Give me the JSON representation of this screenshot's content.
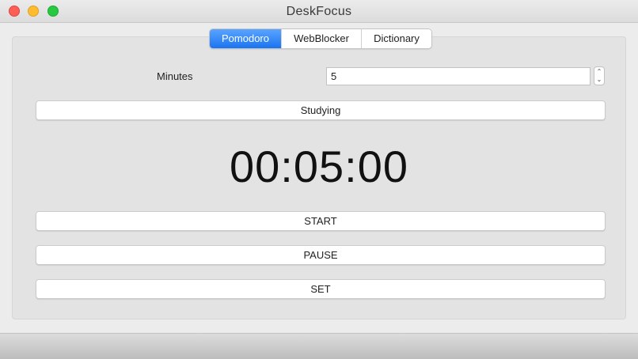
{
  "window": {
    "title": "DeskFocus",
    "accent_color": "#1a74f0",
    "traffic_colors": [
      "#fe5f57",
      "#febc2e",
      "#28c840"
    ]
  },
  "tabs": [
    {
      "label": "Pomodoro",
      "active": true
    },
    {
      "label": "WebBlocker",
      "active": false
    },
    {
      "label": "Dictionary",
      "active": false
    }
  ],
  "pomodoro": {
    "minutes_label": "Minutes",
    "minutes_value": "5",
    "mode_button_label": "Studying",
    "timer_display": "00:05:00",
    "start_label": "START",
    "pause_label": "PAUSE",
    "set_label": "SET"
  },
  "icons": {
    "stepper_up": "chevron-up-icon",
    "stepper_down": "chevron-down-icon"
  }
}
